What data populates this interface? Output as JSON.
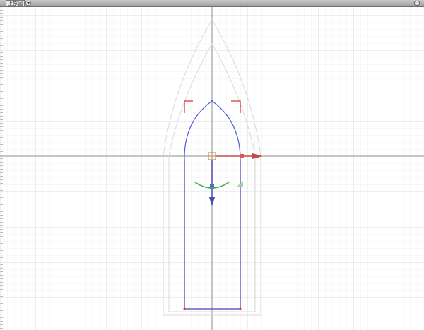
{
  "viewport": {
    "label": "上部図",
    "menu_icon": "chevron-down-icon",
    "maximize_icon": "maximize-icon"
  },
  "colors": {
    "grid_minor": "#ececec",
    "grid_major": "#d8d8d8",
    "axis": "#8c8c8c",
    "shape": "#4f5bd5",
    "selection": "#d23a3a",
    "gizmo_x": "#c24b4b",
    "gizmo_y": "#4b4bb0",
    "gizmo_rotate": "#3fae3f",
    "gizmo_center": "#d98a3a",
    "guide": "#d9d9d9"
  }
}
